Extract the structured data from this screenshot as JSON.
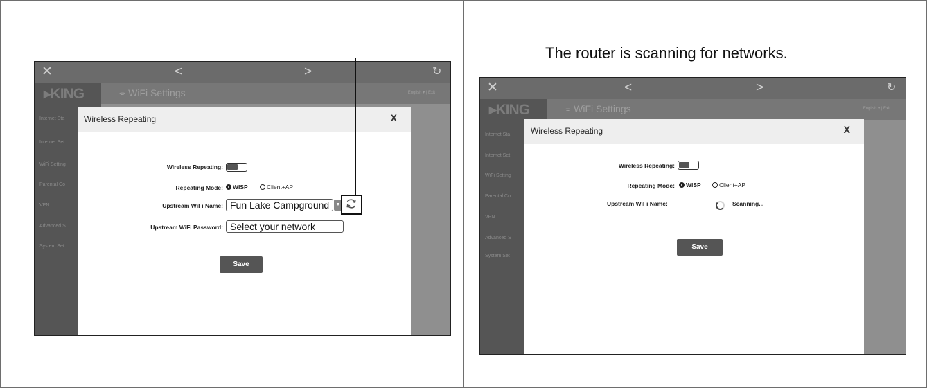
{
  "caption_right": "The router is scanning for networks.",
  "screen_topbar": {
    "close": "✕",
    "back": "<",
    "forward": ">",
    "reload": "↻"
  },
  "brand": "▸KING",
  "page_title": "WiFi Settings",
  "wifi_symbol": "ᯤ",
  "language_bar": "English ▾ | Exit",
  "nav": [
    "Internet Sta",
    "Internet Set",
    "WiFi Setting",
    "Parental Co",
    "VPN",
    "Advanced S",
    "System Set"
  ],
  "dialog": {
    "title": "Wireless Repeating",
    "close": "X",
    "wireless_repeating_label": "Wireless Repeating:",
    "repeating_mode_label": "Repeating Mode:",
    "mode_wisp": "WISP",
    "mode_client_ap": "Client+AP",
    "upstream_name_label": "Upstream WiFi Name:",
    "upstream_password_label": "Upstream WiFi Password:",
    "save_label": "Save"
  },
  "left_dialog": {
    "upstream_name_value": "Fun Lake Campground",
    "upstream_password_value": "Select your network"
  },
  "right_dialog": {
    "scanning_text": "Scanning..."
  },
  "icons": {
    "refresh": "refresh-icon",
    "spinner": "spinner-icon",
    "wifi": "wifi-icon"
  }
}
